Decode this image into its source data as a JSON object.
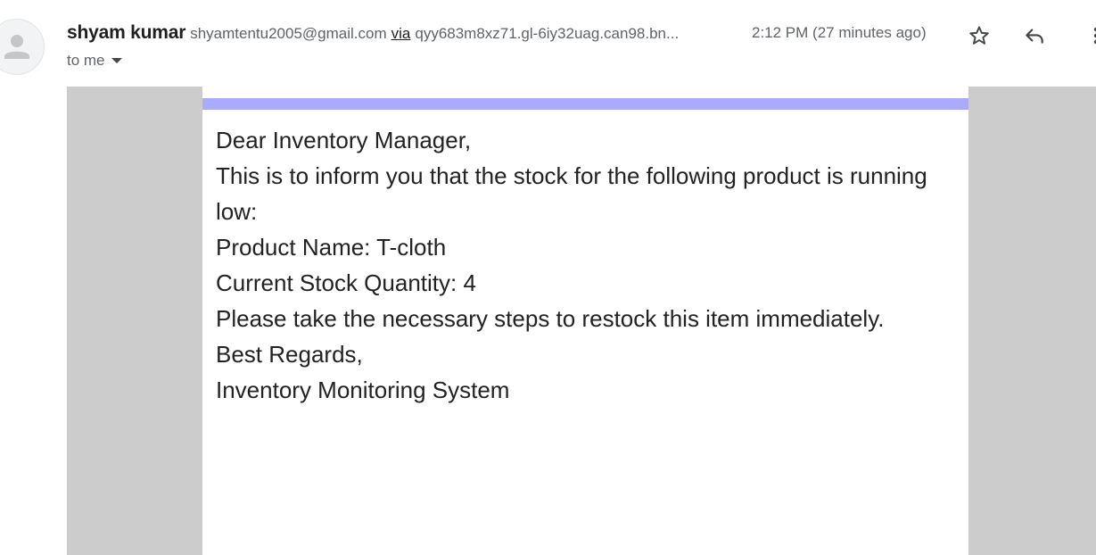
{
  "header": {
    "sender_name": "shyam kumar",
    "sender_email": "shyamtentu2005@gmail.com",
    "via_label": "via",
    "via_domain": "qyy683m8xz71.gl-6iy32uag.can98.bn...",
    "timestamp": "2:12 PM (27 minutes ago)",
    "recipient_label": "to me",
    "icons": {
      "avatar": "person-icon",
      "star": "star-icon",
      "reply": "reply-icon",
      "more": "more-vert-icon"
    }
  },
  "email": {
    "accent_color": "#aaaaff",
    "side_color": "#cccccc",
    "lines": {
      "greeting": "Dear Inventory Manager,",
      "intro": "This is to inform you that the stock for the following product is running low:",
      "product": "Product Name: T-cloth",
      "quantity": "Current Stock Quantity: 4",
      "action": "Please take the necessary steps to restock this item immediately.",
      "closing": "Best Regards,",
      "signature": "Inventory Monitoring System"
    }
  }
}
